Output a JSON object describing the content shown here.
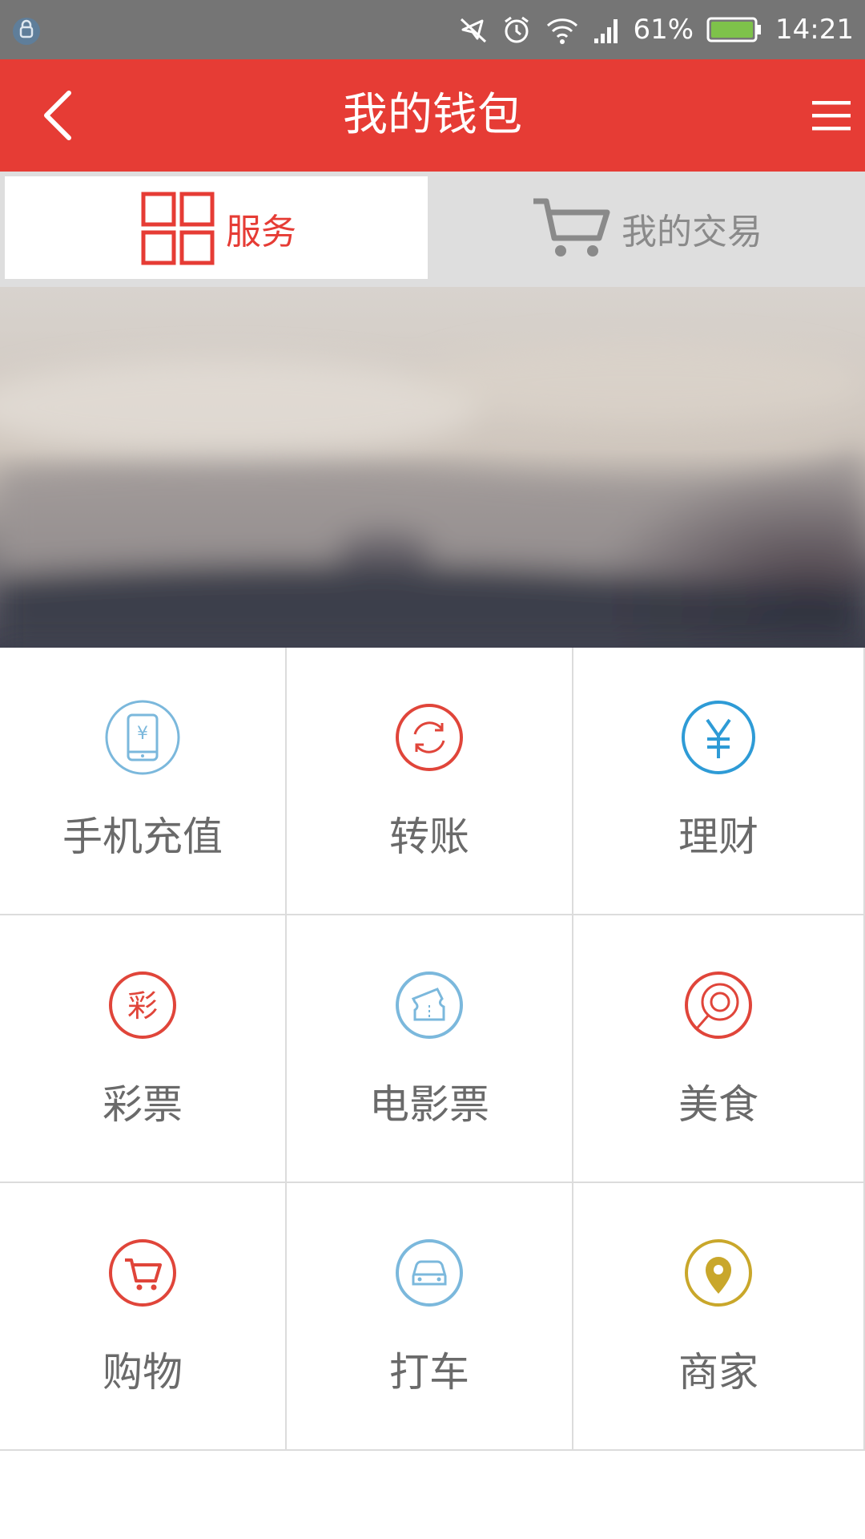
{
  "status_bar": {
    "battery": "61%",
    "time": "14:21"
  },
  "app_bar": {
    "title": "我的钱包",
    "back_icon": "chevron-left-icon",
    "menu_icon": "menu-icon"
  },
  "tabs": [
    {
      "label": "服务",
      "icon": "grid-icon",
      "active": true
    },
    {
      "label": "我的交易",
      "icon": "cart-icon",
      "active": false
    }
  ],
  "services": [
    {
      "label": "手机充值",
      "icon": "phone-recharge-icon",
      "color": "#7bb8dc"
    },
    {
      "label": "转账",
      "icon": "transfer-icon",
      "color": "#e0453a"
    },
    {
      "label": "理财",
      "icon": "yuan-icon",
      "color": "#2e9bd6"
    },
    {
      "label": "彩票",
      "icon": "lottery-icon",
      "color": "#e0453a"
    },
    {
      "label": "电影票",
      "icon": "ticket-icon",
      "color": "#7bb8dc"
    },
    {
      "label": "美食",
      "icon": "food-icon",
      "color": "#e0453a"
    },
    {
      "label": "购物",
      "icon": "shopping-cart-icon",
      "color": "#e0453a"
    },
    {
      "label": "打车",
      "icon": "taxi-icon",
      "color": "#7bb8dc"
    },
    {
      "label": "商家",
      "icon": "location-pin-icon",
      "color": "#c9a72b"
    }
  ],
  "colors": {
    "accent": "#e63c35",
    "status_bar": "#757575",
    "tab_bg": "#dedede",
    "label_gray": "#6a6a6a"
  }
}
